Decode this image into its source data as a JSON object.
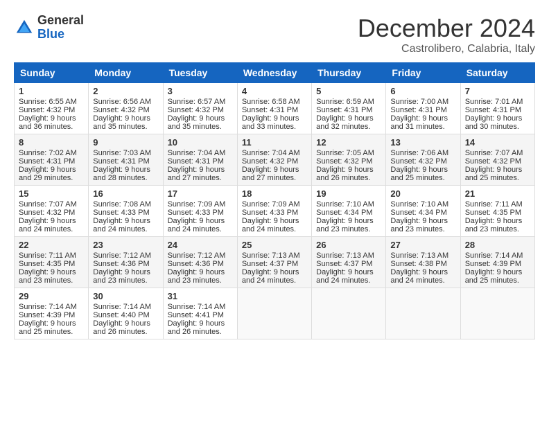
{
  "header": {
    "logo_general": "General",
    "logo_blue": "Blue",
    "month": "December 2024",
    "location": "Castrolibero, Calabria, Italy"
  },
  "columns": [
    "Sunday",
    "Monday",
    "Tuesday",
    "Wednesday",
    "Thursday",
    "Friday",
    "Saturday"
  ],
  "weeks": [
    [
      {
        "day": "1",
        "sunrise": "6:55 AM",
        "sunset": "4:32 PM",
        "daylight": "9 hours and 36 minutes."
      },
      {
        "day": "2",
        "sunrise": "6:56 AM",
        "sunset": "4:32 PM",
        "daylight": "9 hours and 35 minutes."
      },
      {
        "day": "3",
        "sunrise": "6:57 AM",
        "sunset": "4:32 PM",
        "daylight": "9 hours and 35 minutes."
      },
      {
        "day": "4",
        "sunrise": "6:58 AM",
        "sunset": "4:31 PM",
        "daylight": "9 hours and 33 minutes."
      },
      {
        "day": "5",
        "sunrise": "6:59 AM",
        "sunset": "4:31 PM",
        "daylight": "9 hours and 32 minutes."
      },
      {
        "day": "6",
        "sunrise": "7:00 AM",
        "sunset": "4:31 PM",
        "daylight": "9 hours and 31 minutes."
      },
      {
        "day": "7",
        "sunrise": "7:01 AM",
        "sunset": "4:31 PM",
        "daylight": "9 hours and 30 minutes."
      }
    ],
    [
      {
        "day": "8",
        "sunrise": "7:02 AM",
        "sunset": "4:31 PM",
        "daylight": "9 hours and 29 minutes."
      },
      {
        "day": "9",
        "sunrise": "7:03 AM",
        "sunset": "4:31 PM",
        "daylight": "9 hours and 28 minutes."
      },
      {
        "day": "10",
        "sunrise": "7:04 AM",
        "sunset": "4:31 PM",
        "daylight": "9 hours and 27 minutes."
      },
      {
        "day": "11",
        "sunrise": "7:04 AM",
        "sunset": "4:32 PM",
        "daylight": "9 hours and 27 minutes."
      },
      {
        "day": "12",
        "sunrise": "7:05 AM",
        "sunset": "4:32 PM",
        "daylight": "9 hours and 26 minutes."
      },
      {
        "day": "13",
        "sunrise": "7:06 AM",
        "sunset": "4:32 PM",
        "daylight": "9 hours and 25 minutes."
      },
      {
        "day": "14",
        "sunrise": "7:07 AM",
        "sunset": "4:32 PM",
        "daylight": "9 hours and 25 minutes."
      }
    ],
    [
      {
        "day": "15",
        "sunrise": "7:07 AM",
        "sunset": "4:32 PM",
        "daylight": "9 hours and 24 minutes."
      },
      {
        "day": "16",
        "sunrise": "7:08 AM",
        "sunset": "4:33 PM",
        "daylight": "9 hours and 24 minutes."
      },
      {
        "day": "17",
        "sunrise": "7:09 AM",
        "sunset": "4:33 PM",
        "daylight": "9 hours and 24 minutes."
      },
      {
        "day": "18",
        "sunrise": "7:09 AM",
        "sunset": "4:33 PM",
        "daylight": "9 hours and 24 minutes."
      },
      {
        "day": "19",
        "sunrise": "7:10 AM",
        "sunset": "4:34 PM",
        "daylight": "9 hours and 23 minutes."
      },
      {
        "day": "20",
        "sunrise": "7:10 AM",
        "sunset": "4:34 PM",
        "daylight": "9 hours and 23 minutes."
      },
      {
        "day": "21",
        "sunrise": "7:11 AM",
        "sunset": "4:35 PM",
        "daylight": "9 hours and 23 minutes."
      }
    ],
    [
      {
        "day": "22",
        "sunrise": "7:11 AM",
        "sunset": "4:35 PM",
        "daylight": "9 hours and 23 minutes."
      },
      {
        "day": "23",
        "sunrise": "7:12 AM",
        "sunset": "4:36 PM",
        "daylight": "9 hours and 23 minutes."
      },
      {
        "day": "24",
        "sunrise": "7:12 AM",
        "sunset": "4:36 PM",
        "daylight": "9 hours and 23 minutes."
      },
      {
        "day": "25",
        "sunrise": "7:13 AM",
        "sunset": "4:37 PM",
        "daylight": "9 hours and 24 minutes."
      },
      {
        "day": "26",
        "sunrise": "7:13 AM",
        "sunset": "4:37 PM",
        "daylight": "9 hours and 24 minutes."
      },
      {
        "day": "27",
        "sunrise": "7:13 AM",
        "sunset": "4:38 PM",
        "daylight": "9 hours and 24 minutes."
      },
      {
        "day": "28",
        "sunrise": "7:14 AM",
        "sunset": "4:39 PM",
        "daylight": "9 hours and 25 minutes."
      }
    ],
    [
      {
        "day": "29",
        "sunrise": "7:14 AM",
        "sunset": "4:39 PM",
        "daylight": "9 hours and 25 minutes."
      },
      {
        "day": "30",
        "sunrise": "7:14 AM",
        "sunset": "4:40 PM",
        "daylight": "9 hours and 26 minutes."
      },
      {
        "day": "31",
        "sunrise": "7:14 AM",
        "sunset": "4:41 PM",
        "daylight": "9 hours and 26 minutes."
      },
      null,
      null,
      null,
      null
    ]
  ]
}
